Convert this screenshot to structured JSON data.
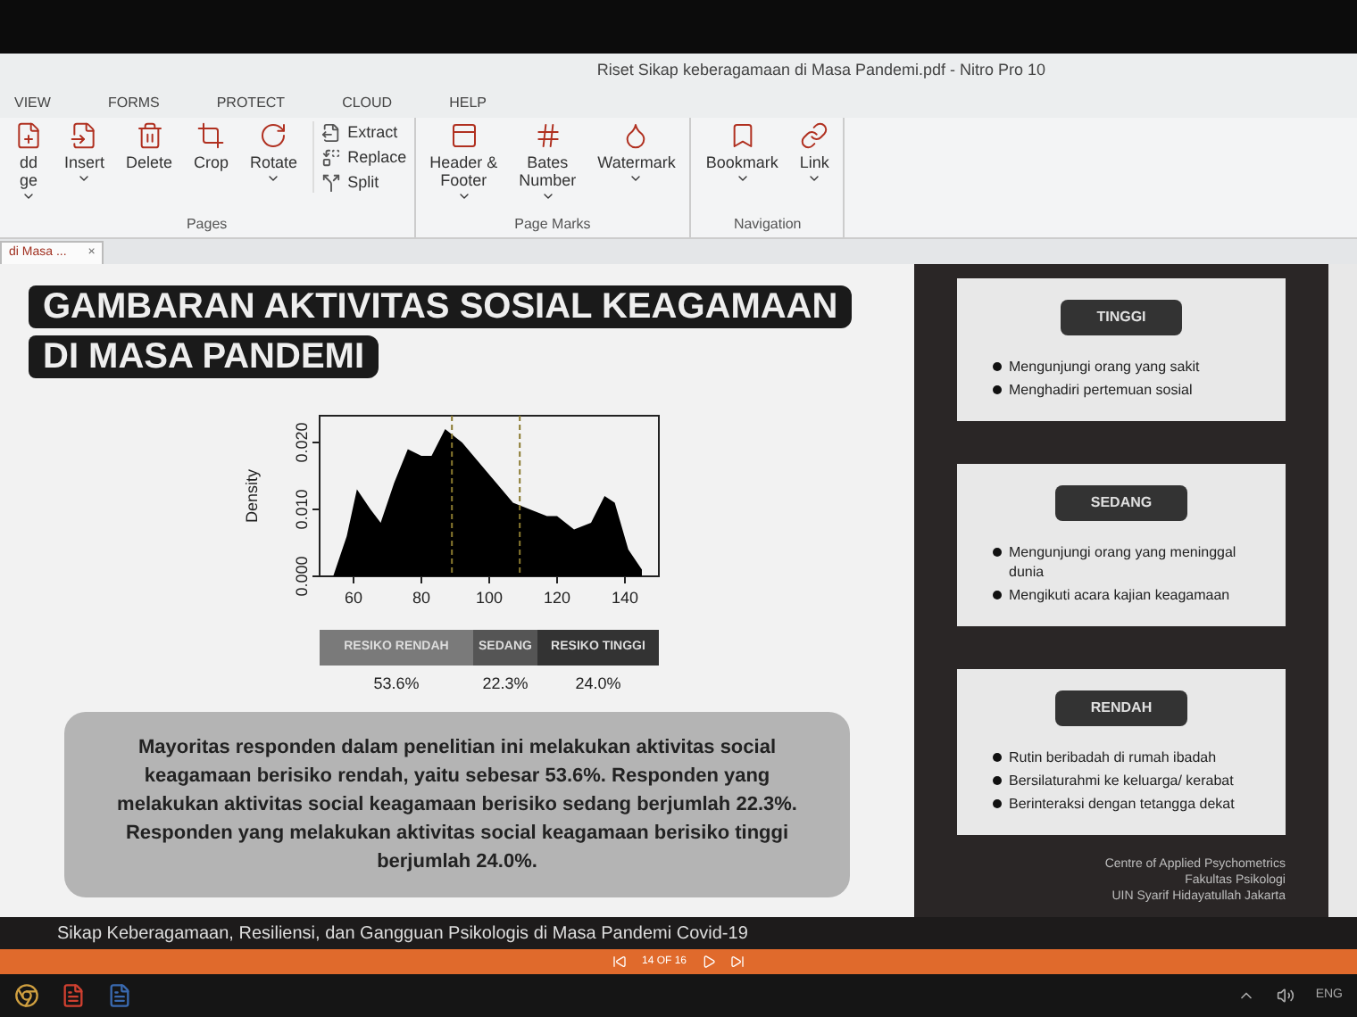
{
  "window": {
    "title": "Riset Sikap keberagamaan di Masa Pandemi.pdf - Nitro Pro 10"
  },
  "menu_tabs": [
    {
      "label": "VIEW",
      "selected": false
    },
    {
      "label": "FORMS",
      "selected": false
    },
    {
      "label": "PROTECT",
      "selected": false
    },
    {
      "label": "CLOUD",
      "selected": false
    },
    {
      "label": "HELP",
      "selected": false
    }
  ],
  "ribbon_groups": [
    {
      "label": "Pages",
      "items": [
        {
          "kind": "large",
          "lines": [
            "dd",
            "ge"
          ],
          "dropdown": true
        },
        {
          "kind": "large",
          "lines": [
            "Insert"
          ],
          "dropdown": true
        },
        {
          "kind": "large",
          "lines": [
            "Delete"
          ],
          "dropdown": false
        },
        {
          "kind": "large",
          "lines": [
            "Crop"
          ],
          "dropdown": false
        },
        {
          "kind": "large",
          "lines": [
            "Rotate"
          ],
          "dropdown": true
        },
        {
          "kind": "small",
          "lines": [
            "Extract"
          ],
          "dropdown": false
        },
        {
          "kind": "small",
          "lines": [
            "Replace"
          ],
          "dropdown": false
        },
        {
          "kind": "small",
          "lines": [
            "Split"
          ],
          "dropdown": false
        }
      ]
    },
    {
      "label": "Page Marks",
      "items": [
        {
          "kind": "large",
          "lines": [
            "Header &",
            "Footer"
          ],
          "dropdown": true
        },
        {
          "kind": "large",
          "lines": [
            "Bates",
            "Number"
          ],
          "dropdown": true
        },
        {
          "kind": "large",
          "lines": [
            "Watermark"
          ],
          "dropdown": true
        }
      ]
    },
    {
      "label": "Navigation",
      "items": [
        {
          "kind": "large",
          "lines": [
            "Bookmark"
          ],
          "dropdown": true
        },
        {
          "kind": "large",
          "lines": [
            "Link"
          ],
          "dropdown": true
        }
      ]
    }
  ],
  "doc_tab": {
    "label": "di Masa ...",
    "close": "×",
    "selected": true
  },
  "slide": {
    "title_lines": [
      "GAMBARAN AKTIVITAS SOSIAL KEAGAMAAN",
      "DI MASA PANDEMI"
    ],
    "chart_data": {
      "type": "area",
      "ylabel": "Density",
      "x": [
        54,
        58,
        61,
        65,
        68,
        72,
        76,
        80,
        83,
        87,
        92,
        97,
        102,
        107,
        112,
        117,
        120,
        125,
        130,
        134,
        137,
        141,
        145
      ],
      "series": [
        {
          "color": "#000000",
          "values": [
            0.0,
            0.006,
            0.013,
            0.01,
            0.008,
            0.014,
            0.019,
            0.018,
            0.018,
            0.022,
            0.02,
            0.017,
            0.014,
            0.011,
            0.01,
            0.009,
            0.009,
            0.007,
            0.008,
            0.012,
            0.011,
            0.004,
            0.001
          ]
        }
      ],
      "xlim": [
        50,
        150
      ],
      "ylim": [
        0,
        0.024
      ],
      "xticks": [
        60,
        80,
        100,
        120,
        140
      ],
      "yticks": [
        {
          "value": 0,
          "label": "0.000"
        },
        {
          "value": 0.01,
          "label": "0.010"
        },
        {
          "value": 0.02,
          "label": "0.020"
        }
      ],
      "ref_lines": [
        {
          "axis": "x",
          "value": 89,
          "color": "#8a7a30"
        },
        {
          "axis": "x",
          "value": 109,
          "color": "#8a7a30"
        }
      ]
    },
    "bands": [
      {
        "label": "RESIKO RENDAH",
        "share": "53.6%",
        "color": "#7a7a7a"
      },
      {
        "label": "SEDANG",
        "share": "22.3%",
        "color": "#555555"
      },
      {
        "label": "RESIKO TINGGI",
        "share": "24.0%",
        "color": "#333333"
      }
    ],
    "summary": "Mayoritas responden dalam penelitian ini melakukan aktivitas social keagamaan berisiko rendah, yaitu sebesar 53.6%. Responden yang melakukan aktivitas social keagamaan berisiko sedang berjumlah 22.3%. Responden yang melakukan aktivitas social keagamaan berisiko tinggi berjumlah 24.0%.",
    "cards": [
      {
        "heading": "TINGGI",
        "bullets": [
          "Mengunjungi orang yang sakit",
          "Menghadiri pertemuan sosial"
        ]
      },
      {
        "heading": "SEDANG",
        "bullets": [
          "Mengunjungi orang yang meninggal dunia",
          "Mengikuti acara kajian keagamaan"
        ]
      },
      {
        "heading": "RENDAH",
        "bullets": [
          "Rutin beribadah di rumah ibadah",
          "Bersilaturahmi ke keluarga/ kerabat",
          "Berinteraksi dengan tetangga dekat"
        ]
      }
    ],
    "credits": [
      "Centre of Applied Psychometrics",
      "Fakultas Psikologi",
      "UIN Syarif Hidayatullah Jakarta"
    ],
    "footer": "Sikap Keberagamaan, Resiliensi, dan Gangguan Psikologis di Masa Pandemi Covid-19"
  },
  "status_bar": {
    "page": "14 OF 16"
  },
  "taskbar": {
    "language": "ENG"
  }
}
